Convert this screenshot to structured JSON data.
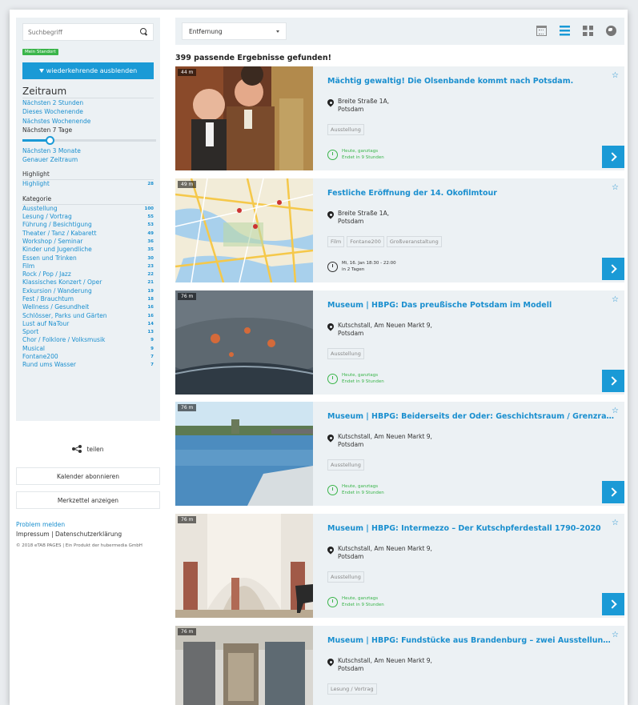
{
  "sidebar": {
    "search_placeholder": "Suchbegriff",
    "location_badge": "Mein Standort",
    "recurring_button": "wiederkehrende ausblenden",
    "zeitraum": {
      "title": "Zeitraum",
      "options": [
        "Nächsten 2 Stunden",
        "Dieses Wochenende",
        "Nächstes Wochenende"
      ],
      "current": "Nächsten 7 Tage",
      "more": [
        "Nächsten 3 Monate",
        "Genauer Zeitraum"
      ]
    },
    "highlight": {
      "title": "Highlight",
      "label": "Highlight",
      "count": "28"
    },
    "kategorie": {
      "title": "Kategorie",
      "items": [
        {
          "label": "Ausstellung",
          "count": "100"
        },
        {
          "label": "Lesung / Vortrag",
          "count": "55"
        },
        {
          "label": "Führung / Besichtigung",
          "count": "53"
        },
        {
          "label": "Theater / Tanz / Kabarett",
          "count": "49"
        },
        {
          "label": "Workshop / Seminar",
          "count": "36"
        },
        {
          "label": "Kinder und Jugendliche",
          "count": "35"
        },
        {
          "label": "Essen und Trinken",
          "count": "30"
        },
        {
          "label": "Film",
          "count": "23"
        },
        {
          "label": "Rock / Pop / Jazz",
          "count": "22"
        },
        {
          "label": "Klassisches Konzert / Oper",
          "count": "21"
        },
        {
          "label": "Exkursion / Wanderung",
          "count": "19"
        },
        {
          "label": "Fest / Brauchtum",
          "count": "18"
        },
        {
          "label": "Wellness / Gesundheit",
          "count": "16"
        },
        {
          "label": "Schlösser, Parks und Gärten",
          "count": "16"
        },
        {
          "label": "Lust auf NaTour",
          "count": "14"
        },
        {
          "label": "Sport",
          "count": "13"
        },
        {
          "label": "Chor / Folklore / Volksmusik",
          "count": "9"
        },
        {
          "label": "Musical",
          "count": "9"
        },
        {
          "label": "Fontane200",
          "count": "7"
        },
        {
          "label": "Rund ums Wasser",
          "count": "7"
        }
      ]
    },
    "share_label": "teilen",
    "calendar_button": "Kalender abonnieren",
    "watchlist_button": "Merkzettel anzeigen",
    "problem_link": "Problem melden",
    "impressum": "Impressum | Datenschutzerklärung",
    "copyright": "© 2018 eTAB PAGES | Ein Produkt der hubermedia GmbH"
  },
  "toolbar": {
    "sort_value": "Entfernung",
    "icons": [
      "calendar-icon",
      "list-icon",
      "grid-icon",
      "globe-icon"
    ]
  },
  "results_text": "399 passende Ergebnisse gefunden!",
  "events": [
    {
      "distance": "44 m",
      "title": "Mächtig gewaltig! Die Olsenbande kommt nach Potsdam.",
      "address_line1": "Breite Straße 1A,",
      "address_line2": "Potsdam",
      "tags": [
        "Ausstellung"
      ],
      "time_line1": "Heute, ganztags",
      "time_line2": "Endet in 9 Stunden",
      "ongoing": true
    },
    {
      "distance": "49 m",
      "title": "Festliche Eröffnung der 14. Ökofilmtour",
      "address_line1": "Breite Straße 1A,",
      "address_line2": "Potsdam",
      "tags": [
        "Film",
        "Fontane200",
        "Großveranstaltung"
      ],
      "time_line1": "Mi, 16. Jan 18:30 - 22:00",
      "time_line2": "in 2 Tagen",
      "ongoing": false
    },
    {
      "distance": "76 m",
      "title": "Museum | HBPG: Das preußische Potsdam im Modell",
      "address_line1": "Kutschstall, Am Neuen Markt 9,",
      "address_line2": "Potsdam",
      "tags": [
        "Ausstellung"
      ],
      "time_line1": "Heute, ganztags",
      "time_line2": "Endet in 9 Stunden",
      "ongoing": true
    },
    {
      "distance": "76 m",
      "title": "Museum | HBPG: Beiderseits der Oder: Geschichtsraum / Grenzraum",
      "address_line1": "Kutschstall, Am Neuen Markt 9,",
      "address_line2": "Potsdam",
      "tags": [
        "Ausstellung"
      ],
      "time_line1": "Heute, ganztags",
      "time_line2": "Endet in 9 Stunden",
      "ongoing": true
    },
    {
      "distance": "76 m",
      "title": "Museum | HBPG: Intermezzo – Der Kutschpferdestall 1790–2020",
      "address_line1": "Kutschstall, Am Neuen Markt 9,",
      "address_line2": "Potsdam",
      "tags": [
        "Ausstellung"
      ],
      "time_line1": "Heute, ganztags",
      "time_line2": "Endet in 9 Stunden",
      "ongoing": true
    },
    {
      "distance": "76 m",
      "title": "Museum | HBPG: Fundstücke aus Brandenburg – zwei Ausstellungen",
      "address_line1": "Kutschstall, Am Neuen Markt 9,",
      "address_line2": "Potsdam",
      "tags": [
        "Lesung / Vortrag"
      ],
      "time_line1": "",
      "time_line2": "",
      "ongoing": true
    }
  ],
  "colors": {
    "accent": "#1a9ad6",
    "link": "#1a8fcf",
    "green": "#3ab54a",
    "panel": "#ecf1f4"
  }
}
